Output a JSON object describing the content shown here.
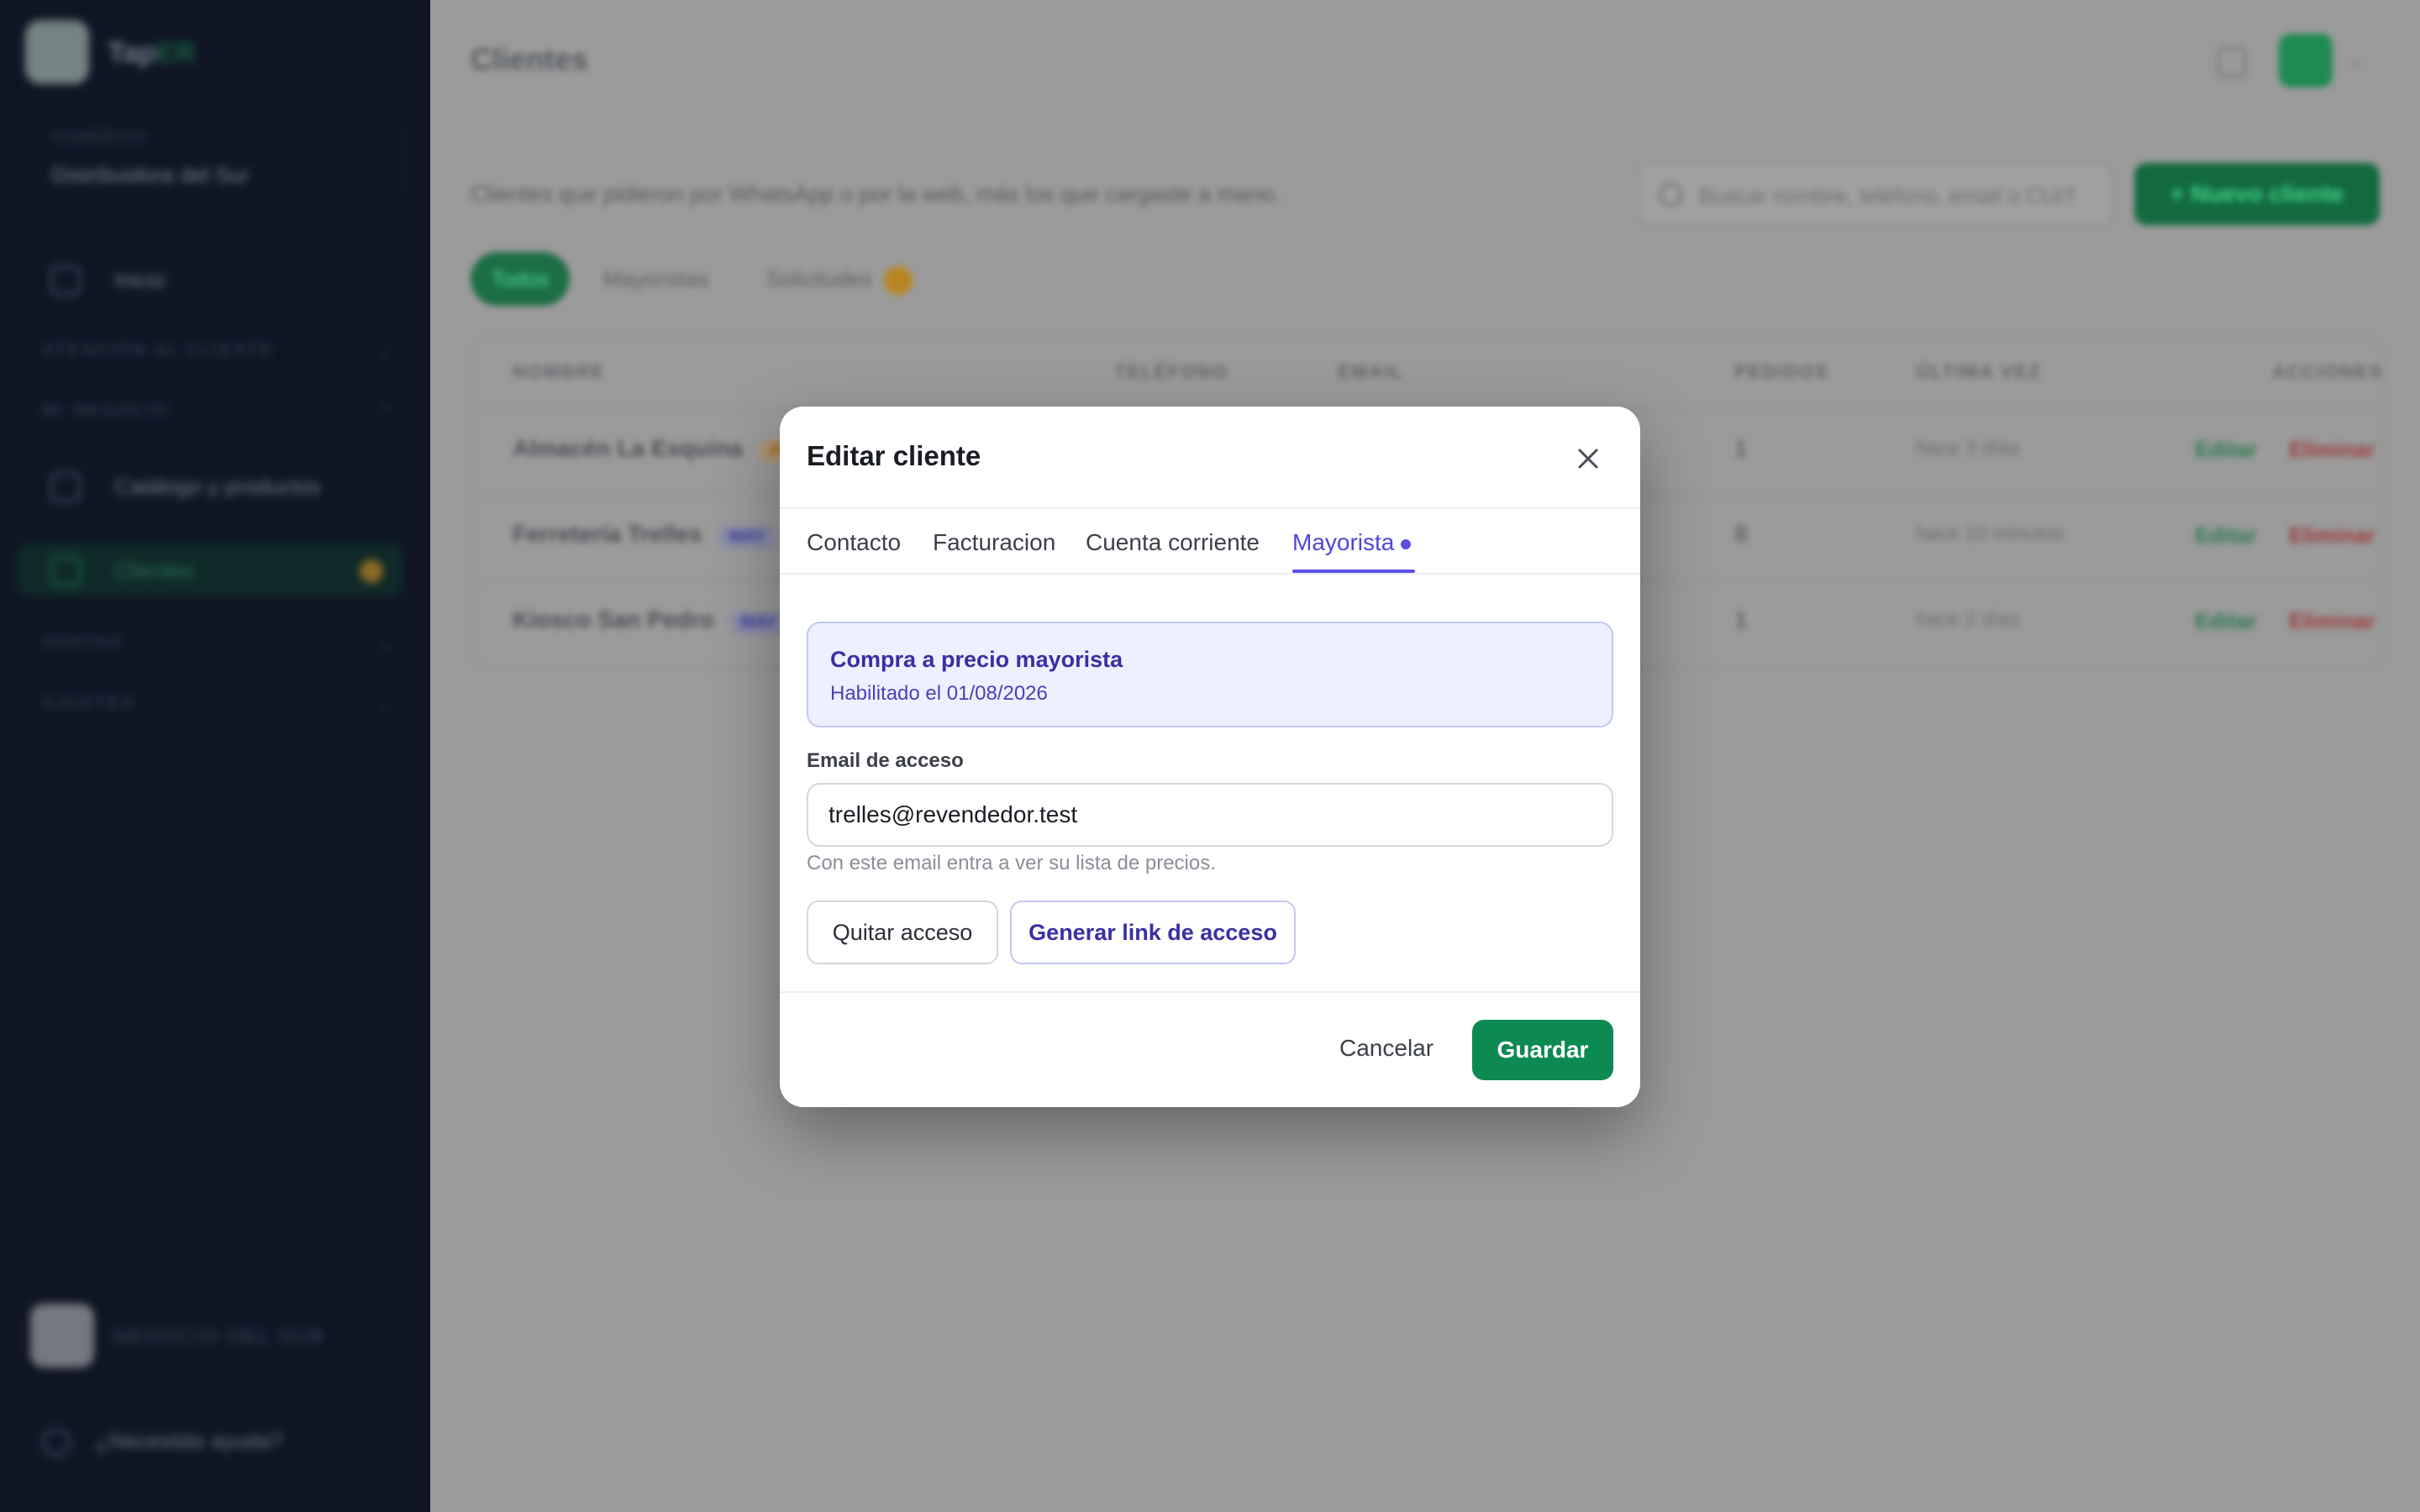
{
  "sidebar": {
    "brand_prefix": "Tap",
    "brand_suffix": "ER",
    "company_label": "COMERCIO",
    "company_name": "Distribuidora del Sur",
    "items": [
      {
        "label": "Inicio"
      },
      {
        "label": "Catálogo y productos"
      },
      {
        "label": "Clientes"
      }
    ],
    "sections": [
      {
        "label": "ATENCIÓN AL CLIENTE"
      },
      {
        "label": "MI NEGOCIO"
      },
      {
        "label": "VENTAS"
      },
      {
        "label": "AJUSTES"
      }
    ],
    "user_name": "NEGOCIO DEL SUR",
    "help_label": "¿Necesitás ayuda?"
  },
  "header": {
    "page_title": "Clientes"
  },
  "main": {
    "subtitle": "Clientes que pidieron por WhatsApp o por la web, más los que cargaste a mano.",
    "search_placeholder": "Buscar nombre, teléfono, email o CUIT",
    "new_button": "+ Nuevo cliente",
    "filters": {
      "all": "Todos",
      "wholesale": "Mayoristas",
      "requests": "Solicitudes"
    },
    "table": {
      "columns": [
        "NOMBRE",
        "TELÉFONO",
        "EMAIL",
        "PEDIDOS",
        "ÚLTIMA VEZ",
        "ACCIONES"
      ],
      "rows": [
        {
          "name": "Almacén La Esquina",
          "tag": "PEND",
          "orders": "1",
          "last": "hace 3 días",
          "edit": "Editar",
          "delete": "Eliminar"
        },
        {
          "name": "Ferretería Trelles",
          "tag": "MAY",
          "orders": "8",
          "last": "hace 10 minutos",
          "edit": "Editar",
          "delete": "Eliminar"
        },
        {
          "name": "Kiosco San Pedro",
          "tag": "MAY",
          "orders": "1",
          "last": "hace 2 días",
          "edit": "Editar",
          "delete": "Eliminar"
        }
      ]
    }
  },
  "modal": {
    "title": "Editar cliente",
    "tabs": [
      "Contacto",
      "Facturacion",
      "Cuenta corriente",
      "Mayorista"
    ],
    "active_tab": "Mayorista",
    "info": {
      "title": "Compra a precio mayorista",
      "subtitle": "Habilitado el 01/08/2026"
    },
    "email_label": "Email de acceso",
    "email_value": "trelles@revendedor.test",
    "email_help": "Con este email entra a ver su lista de precios.",
    "remove_access": "Quitar acceso",
    "generate_link": "Generar link de acceso",
    "cancel": "Cancelar",
    "save": "Guardar"
  },
  "colors": {
    "accent_green": "#0c8a52",
    "accent_indigo": "#5b50e0",
    "sidebar_bg": "#0f1525",
    "pending_badge": "#f2b227"
  },
  "icons": {
    "close": "close-icon",
    "search": "search-icon",
    "help": "help-circle-icon"
  }
}
